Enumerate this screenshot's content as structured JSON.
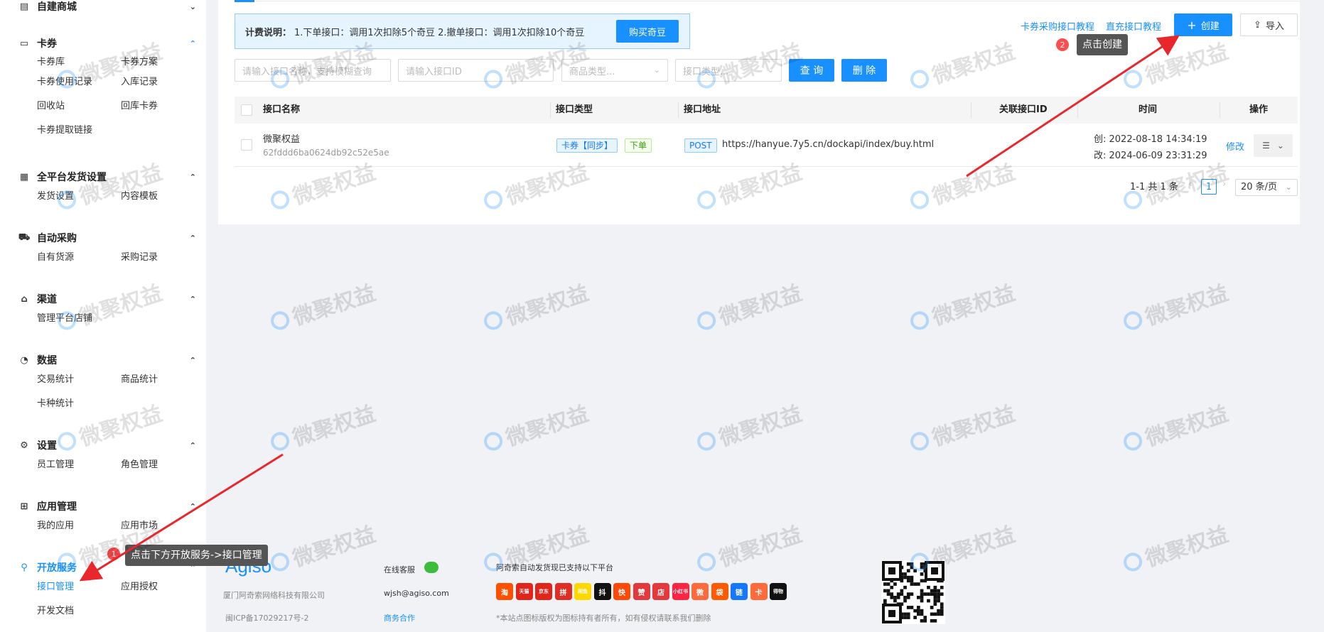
{
  "sidebar": {
    "groups": [
      {
        "title": "自建商城",
        "icon": "store-icon",
        "chevron": "down",
        "items": []
      },
      {
        "title": "卡券",
        "icon": "card-icon",
        "chevron": "up-blue",
        "items": [
          "卡券库",
          "卡券方案",
          "卡券使用记录",
          "入库记录",
          "回收站",
          "回库卡券",
          "卡券提取链接"
        ]
      },
      {
        "title": "全平台发货设置",
        "icon": "grid-icon",
        "chevron": "up",
        "items": [
          "发货设置",
          "内容模板"
        ]
      },
      {
        "title": "自动采购",
        "icon": "cart-icon",
        "chevron": "up",
        "items": [
          "自有货源",
          "采购记录"
        ]
      },
      {
        "title": "渠道",
        "icon": "shop-icon",
        "chevron": "up",
        "items": [
          "管理平台店铺"
        ]
      },
      {
        "title": "数据",
        "icon": "pie-icon",
        "chevron": "up",
        "items": [
          "交易统计",
          "商品统计",
          "卡种统计"
        ]
      },
      {
        "title": "设置",
        "icon": "gear-icon",
        "chevron": "up",
        "items": [
          "员工管理",
          "角色管理"
        ]
      },
      {
        "title": "应用管理",
        "icon": "apps-icon",
        "chevron": "up",
        "items": [
          "我的应用",
          "应用市场"
        ]
      },
      {
        "title": "开放服务",
        "icon": "plug-icon",
        "chevron": "up",
        "items": [
          "接口管理",
          "应用授权",
          "开发文档"
        ]
      }
    ]
  },
  "billing": {
    "label": "计费说明：",
    "text": "1.下单接口：调用1次扣除5个奇豆 2.撤单接口：调用1次扣除10个奇豆",
    "buy_button": "购买奇豆"
  },
  "toolbar": {
    "link_card_tutorial": "卡券采购接口教程",
    "link_recharge_tutorial": "直充接口教程",
    "create_button": "创建",
    "import_button": "导入"
  },
  "annotations": {
    "step1_badge": "1",
    "step1_text": "点击下方开放服务->接口管理",
    "step2_badge": "2",
    "step2_text": "点击创建"
  },
  "filters": {
    "name_placeholder": "请输入接口名称，支持模糊查询",
    "id_placeholder": "请输入接口ID",
    "goods_type_placeholder": "商品类型...",
    "api_type_placeholder": "接口类型...",
    "query_button": "查 询",
    "delete_button": "删 除"
  },
  "table": {
    "headers": [
      "接口名称",
      "接口类型",
      "接口地址",
      "关联接口ID",
      "时间",
      "操作"
    ],
    "rows": [
      {
        "name": "微聚权益",
        "id": "62fddd6ba0624db92c52e5ae",
        "type_tag": "卡券【同步】",
        "order_tag": "下单",
        "method": "POST",
        "url": "https://hanyue.7y5.cn/dockapi/index/buy.html",
        "created": "创:  2022-08-18 14:34:19",
        "modified": "改:  2024-06-09 23:31:29",
        "edit": "修改"
      }
    ]
  },
  "pagination": {
    "summary": "1-1 共 1 条",
    "current": "1",
    "page_size": "20 条/页"
  },
  "footer": {
    "logo": "Agiso",
    "company": "厦门阿奇索网络科技有限公司",
    "icp": "闽ICP备17029217号-2",
    "service_label": "在线客服",
    "email": "wjsh@agiso.com",
    "business": "商务合作",
    "platforms_title": "阿奇索自动发货现已支持以下平台",
    "platforms_note": "*本站点图标版权为图标持有者所有，如有侵权请联系我们删除",
    "platforms": [
      {
        "label": "淘",
        "color": "#ff5000"
      },
      {
        "label": "天猫",
        "color": "#e1251b"
      },
      {
        "label": "京东",
        "color": "#e1251b"
      },
      {
        "label": "拼",
        "color": "#e02e24"
      },
      {
        "label": "闲鱼",
        "color": "#ffd800"
      },
      {
        "label": "抖",
        "color": "#111111"
      },
      {
        "label": "快",
        "color": "#ff4906"
      },
      {
        "label": "赞",
        "color": "#e4393c"
      },
      {
        "label": "店",
        "color": "#e4393c"
      },
      {
        "label": "小红书",
        "color": "#ff2442"
      },
      {
        "label": "微",
        "color": "#ff6a3d"
      },
      {
        "label": "袋",
        "color": "#ff5a00"
      },
      {
        "label": "链",
        "color": "#1677ff"
      },
      {
        "label": "卡",
        "color": "#ff6a3d"
      },
      {
        "label": "得物",
        "color": "#111111"
      }
    ]
  },
  "watermark": {
    "text": "微聚权益"
  },
  "colors": {
    "primary": "#1890ff",
    "annotation_arrow": "#e8262b",
    "tooltip_bg": "#555555"
  }
}
